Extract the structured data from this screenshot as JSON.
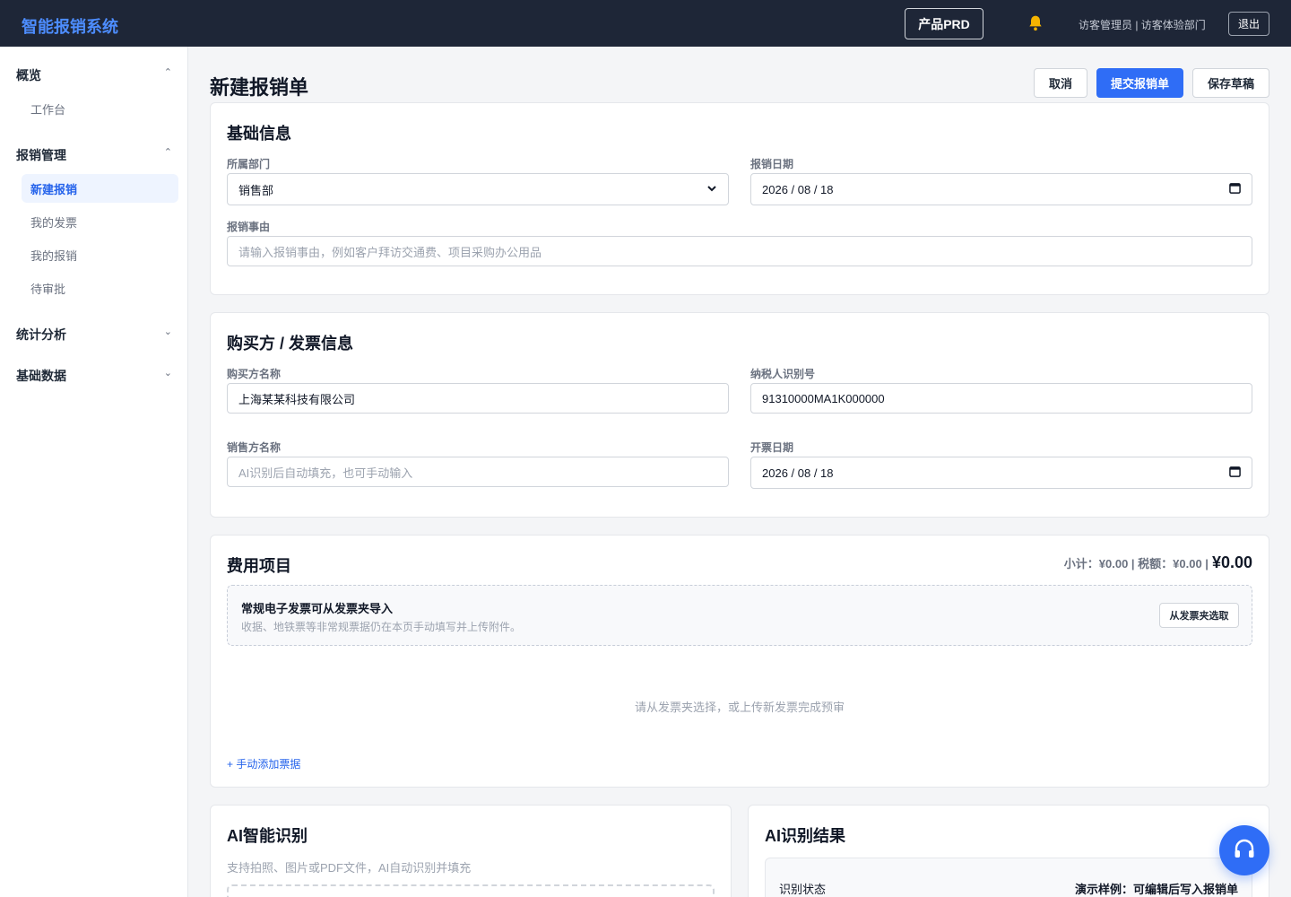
{
  "app": {
    "title": "智能报销系统"
  },
  "header": {
    "prd_label": "产品PRD",
    "user_info": "访客管理员 | 访客体验部门",
    "logout_label": "退出"
  },
  "sidebar": {
    "groups": [
      {
        "label": "概览",
        "expanded": true,
        "chevron": "⌃",
        "items": [
          {
            "label": "工作台"
          }
        ]
      },
      {
        "label": "报销管理",
        "expanded": true,
        "chevron": "⌃",
        "items": [
          {
            "label": "新建报销",
            "active": true
          },
          {
            "label": "我的发票"
          },
          {
            "label": "我的报销"
          },
          {
            "label": "待审批"
          }
        ]
      },
      {
        "label": "统计分析",
        "expanded": false,
        "chevron": "⌄"
      },
      {
        "label": "基础数据",
        "expanded": false,
        "chevron": "⌄"
      }
    ]
  },
  "page": {
    "title": "新建报销单",
    "actions": {
      "cancel": "取消",
      "submit": "提交报销单",
      "save_draft": "保存草稿"
    }
  },
  "basic_info": {
    "title": "基础信息",
    "department_label": "所属部门",
    "department_value": "销售部",
    "date_label": "报销日期",
    "date_value": "2026 / 08 / 18",
    "reason_label": "报销事由",
    "reason_placeholder": "请输入报销事由，例如客户拜访交通费、项目采购办公用品"
  },
  "buyer_info": {
    "title": "购买方 / 发票信息",
    "buyer_name_label": "购买方名称",
    "buyer_name_value": "上海某某科技有限公司",
    "tax_id_label": "纳税人识别号",
    "tax_id_value": "91310000MA1K000000",
    "seller_name_label": "销售方名称",
    "seller_name_placeholder": "AI识别后自动填充，也可手动输入",
    "invoice_date_label": "开票日期",
    "invoice_date_value": "2026 / 08 / 18"
  },
  "expense_items": {
    "title": "费用项目",
    "subtotal_text": "小计：¥0.00 | 税额：¥0.00 |",
    "grand_total": "¥0.00",
    "notice_title": "常规电子发票可从发票夹导入",
    "notice_sub": "收据、地铁票等非常规票据仍在本页手动填写并上传附件。",
    "notice_button": "从发票夹选取",
    "empty_text": "请从发票夹选择，或上传新发票完成预审",
    "add_link": "+ 手动添加票据"
  },
  "ai_recognition": {
    "title": "AI智能识别",
    "subtitle": "支持拍照、图片或PDF文件，AI自动识别并填充"
  },
  "ai_result": {
    "title": "AI识别结果",
    "status_label": "识别状态",
    "status_value": "演示样例：可编辑后写入报销单"
  },
  "colors": {
    "topbar": "#1e2637",
    "brand": "#4d8dff",
    "primary": "#2f6df6"
  }
}
